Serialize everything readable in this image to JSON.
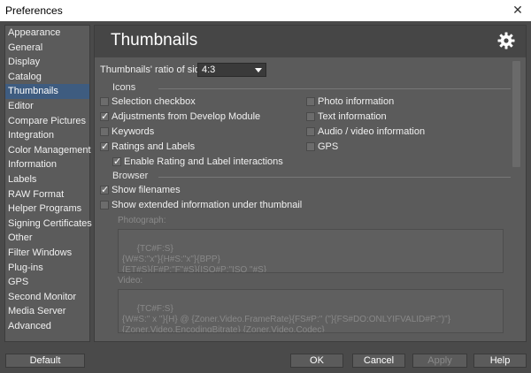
{
  "window": {
    "title": "Preferences",
    "close_glyph": "✕"
  },
  "sidebar": {
    "items": [
      {
        "label": "Appearance"
      },
      {
        "label": "General"
      },
      {
        "label": "Display"
      },
      {
        "label": "Catalog"
      },
      {
        "label": "Thumbnails",
        "selected": true
      },
      {
        "label": "Editor"
      },
      {
        "label": "Compare Pictures"
      },
      {
        "label": "Integration"
      },
      {
        "label": "Color Management"
      },
      {
        "label": "Information"
      },
      {
        "label": "Labels"
      },
      {
        "label": "RAW Format"
      },
      {
        "label": "Helper Programs"
      },
      {
        "label": "Signing Certificates"
      },
      {
        "label": "Other"
      },
      {
        "label": "Filter Windows"
      },
      {
        "label": "Plug-ins"
      },
      {
        "label": "GPS"
      },
      {
        "label": "Second Monitor"
      },
      {
        "label": "Media Server"
      },
      {
        "label": "Advanced"
      }
    ]
  },
  "main": {
    "title": "Thumbnails",
    "gear_icon": "gear-icon",
    "ratio": {
      "label": "Thumbnails' ratio of sides:",
      "value": "4:3"
    },
    "icons_section": {
      "label": "Icons",
      "left": [
        {
          "label": "Selection checkbox",
          "checked": false
        },
        {
          "label": "Adjustments from Develop Module",
          "checked": true
        },
        {
          "label": "Keywords",
          "checked": false
        },
        {
          "label": "Ratings and Labels",
          "checked": true
        },
        {
          "label": "Enable Rating and Label interactions",
          "checked": true
        }
      ],
      "right": [
        {
          "label": "Photo information",
          "checked": false
        },
        {
          "label": "Text information",
          "checked": false
        },
        {
          "label": "Audio / video information",
          "checked": false
        },
        {
          "label": "GPS",
          "checked": false
        }
      ]
    },
    "browser_section": {
      "label": "Browser",
      "items": [
        {
          "label": "Show filenames",
          "checked": true
        },
        {
          "label": "Show extended information under thumbnail",
          "checked": false
        }
      ]
    },
    "photograph": {
      "label": "Photograph:",
      "text": "{TC#F:S}\n{W#S:\"x\"}{H#S:\"x\"}{BPP}\n{ET#S}{F#P:\"F\"#S}{ISO#P:\"ISO \"#S}"
    },
    "video": {
      "label": "Video:",
      "text": "{TC#F:S}\n{W#S:\" x \"}{H} @ {Zoner.Video.FrameRate}{FS#P:\" (\"}{FS#DO:ONLYIFVALID#P:\")\"}\n{Zoner.Video.EncodingBitrate} {Zoner.Video.Codec}"
    }
  },
  "footer": {
    "default": "Default",
    "ok": "OK",
    "cancel": "Cancel",
    "apply": "Apply",
    "help": "Help"
  }
}
